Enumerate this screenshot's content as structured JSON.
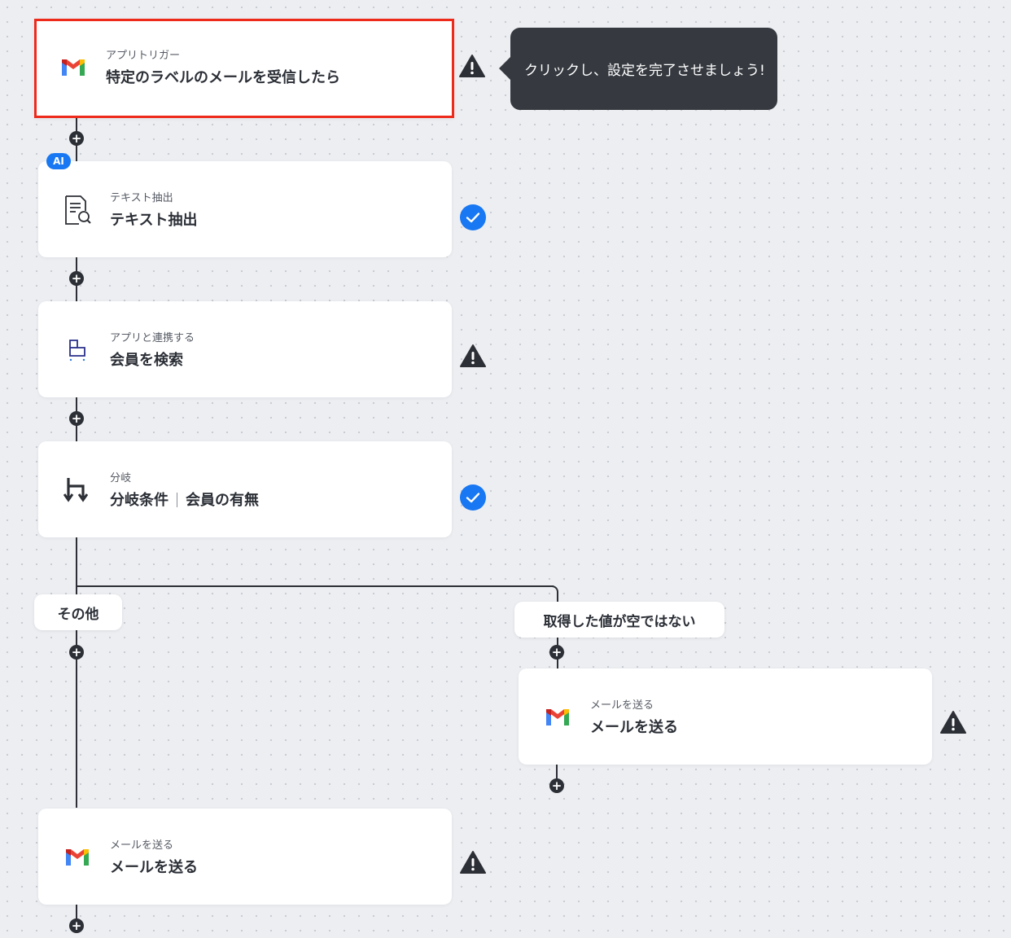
{
  "tooltip": {
    "text": "クリックし、設定を完了させましょう!"
  },
  "steps": [
    {
      "sub": "アプリトリガー",
      "title": "特定のラベルのメールを受信したら",
      "icon": "gmail-icon",
      "status": "warning"
    },
    {
      "sub": "テキスト抽出",
      "title": "テキスト抽出",
      "icon": "document-search-icon",
      "badge": "AI",
      "status": "done"
    },
    {
      "sub": "アプリと連携する",
      "title": "会員を検索",
      "icon": "app-connector-icon",
      "status": "warning"
    },
    {
      "sub": "分岐",
      "title_main": "分岐条件",
      "title_detail": "会員の有無",
      "icon": "branch-icon",
      "status": "done"
    }
  ],
  "branches": {
    "other": {
      "label": "その他",
      "step": {
        "sub": "メールを送る",
        "title": "メールを送る",
        "icon": "gmail-icon",
        "status": "warning"
      }
    },
    "not_empty": {
      "label": "取得した値が空ではない",
      "step": {
        "sub": "メールを送る",
        "title": "メールを送る",
        "icon": "gmail-icon",
        "status": "warning"
      }
    }
  },
  "colors": {
    "accent": "#1877f2",
    "warning": "#2c2f35",
    "selected_border": "#ee2a1b"
  }
}
